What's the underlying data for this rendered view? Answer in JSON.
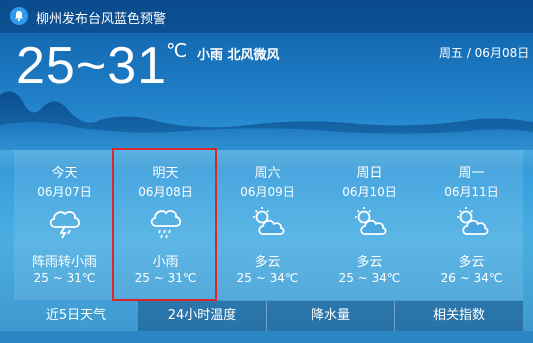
{
  "alert": {
    "icon": "bell-icon",
    "text": "柳州发布台风蓝色预警"
  },
  "current": {
    "temp_range": "25~31",
    "unit": "℃",
    "condition": "小雨  北风微风",
    "date": "周五 / 06月08日"
  },
  "forecast": [
    {
      "name": "今天",
      "date": "06月07日",
      "icon": "thunder-rain-icon",
      "desc": "阵雨转小雨",
      "range": "25 ~ 31℃"
    },
    {
      "name": "明天",
      "date": "06月08日",
      "icon": "light-rain-icon",
      "desc": "小雨",
      "range": "25 ~ 31℃"
    },
    {
      "name": "周六",
      "date": "06月09日",
      "icon": "partly-cloudy-icon",
      "desc": "多云",
      "range": "25 ~ 34℃"
    },
    {
      "name": "周日",
      "date": "06月10日",
      "icon": "partly-cloudy-icon",
      "desc": "多云",
      "range": "25 ~ 34℃"
    },
    {
      "name": "周一",
      "date": "06月11日",
      "icon": "partly-cloudy-icon",
      "desc": "多云",
      "range": "26 ~ 34℃"
    }
  ],
  "tabs": [
    {
      "label": "近5日天气",
      "active": true
    },
    {
      "label": "24小时温度",
      "active": false
    },
    {
      "label": "降水量",
      "active": false
    },
    {
      "label": "相关指数",
      "active": false
    }
  ],
  "colors": {
    "highlight_border": "#d9272c",
    "bell_bg": "#2f9bf0"
  }
}
